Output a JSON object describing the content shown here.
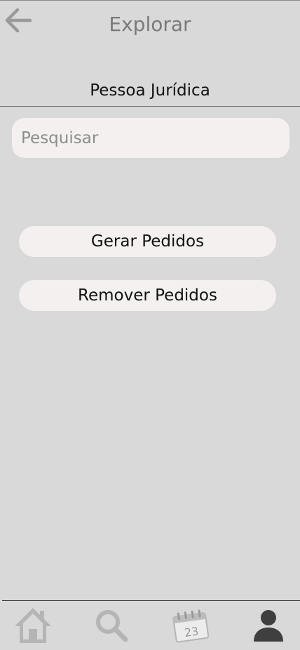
{
  "header": {
    "title": "Explorar",
    "back_icon": "arrow-left-icon"
  },
  "section": {
    "title": "Pessoa Jurídica"
  },
  "search": {
    "placeholder": "Pesquisar",
    "value": ""
  },
  "actions": {
    "generate_label": "Gerar Pedidos",
    "remove_label": "Remover Pedidos"
  },
  "bottom_nav": {
    "items": [
      {
        "icon": "home-icon",
        "active": false
      },
      {
        "icon": "search-icon",
        "active": false
      },
      {
        "icon": "calendar-icon",
        "day": "23",
        "active": false
      },
      {
        "icon": "user-icon",
        "active": true
      }
    ]
  },
  "colors": {
    "background": "#d9d9d9",
    "surface": "#f4f0f0",
    "muted": "#7a7a7a",
    "nav_inactive": "#b5b5b5",
    "nav_active": "#3f3f3f"
  }
}
